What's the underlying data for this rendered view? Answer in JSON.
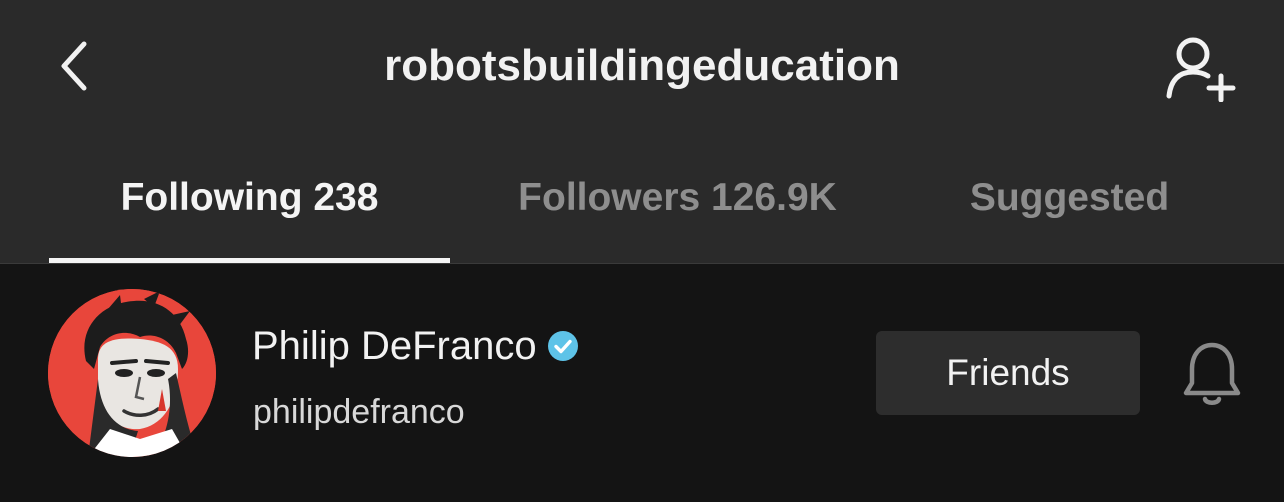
{
  "header": {
    "back_icon": "chevron-left-icon",
    "title": "robotsbuildingeducation",
    "add_user_icon": "add-user-icon"
  },
  "tabs": [
    {
      "label": "Following 238",
      "active": true
    },
    {
      "label": "Followers 126.9K",
      "active": false
    },
    {
      "label": "Suggested",
      "active": false
    }
  ],
  "list": [
    {
      "name": "Philip DeFranco",
      "verified": true,
      "handle": "philipdefranco",
      "avatar_icon": "profile-avatar",
      "button_label": "Friends",
      "bell_icon": "bell-icon"
    }
  ],
  "colors": {
    "header_bg": "#2a2a2a",
    "list_bg": "#141414",
    "verified_blue": "#5ec3e8",
    "avatar_red": "#e8463b"
  }
}
